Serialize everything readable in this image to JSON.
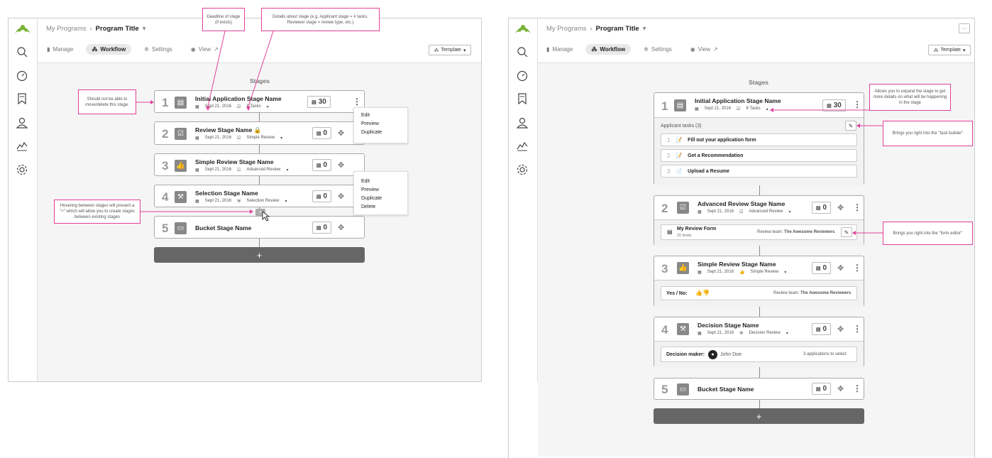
{
  "left": {
    "breadcrumb": {
      "root": "My Programs",
      "sep": "›",
      "current": "Program Title",
      "caret": "▾"
    },
    "tabs": [
      {
        "label": "Manage",
        "icon": "bookmark-icon"
      },
      {
        "label": "Workflow",
        "icon": "sitemap-icon",
        "active": true
      },
      {
        "label": "Settings",
        "icon": "gear-icon"
      },
      {
        "label": "View",
        "icon": "eye-icon"
      }
    ],
    "template_label": "Template",
    "stages_title": "Stages",
    "stages": [
      {
        "num": "1",
        "name": "Initial Application Stage Name",
        "date": "Sept 21, 2016",
        "detail": "8 Tasks",
        "count": "30",
        "icon": "document-icon"
      },
      {
        "num": "2",
        "name": "Review Stage Name",
        "date": "",
        "detail": "Simple Review",
        "count": "0",
        "icon": "checkbox-icon"
      },
      {
        "num": "3",
        "name": "Simple Review Stage Name",
        "date": "Sept 21, 2016",
        "detail": "Advanced Review",
        "count": "0",
        "icon": "thumbs-up-icon"
      },
      {
        "num": "4",
        "name": "Selection Stage Name",
        "date": "Sept 21, 2016",
        "detail": "Selection Review",
        "count": "0",
        "icon": "gavel-icon"
      },
      {
        "num": "5",
        "name": "Bucket Stage Name",
        "date": "",
        "detail": "",
        "count": "0",
        "icon": "inbox-icon"
      }
    ],
    "menu1": [
      "Edit",
      "Preview",
      "Duplicate"
    ],
    "menu2": [
      "Edit",
      "Preview",
      "Duplicate",
      "Delete"
    ],
    "notes": {
      "deadline": "Deadline of stage (if exists)",
      "details": "Details about stage (e.g. Applicant stage = # tasks, Reviewer stage = review type, etc.)",
      "nomove": "Should not be able to move/delete this stage.",
      "hover": "Hovering between stages will present a \"+\" which will allow you to create stages between existing stages"
    },
    "add": "+"
  },
  "right": {
    "breadcrumb": {
      "root": "My Programs",
      "sep": "›",
      "current": "Program Title",
      "caret": "▾"
    },
    "more": "···",
    "tabs": [
      {
        "label": "Manage"
      },
      {
        "label": "Workflow",
        "active": true
      },
      {
        "label": "Settings"
      },
      {
        "label": "View"
      }
    ],
    "template_label": "Template",
    "stages_title": "Stages",
    "stage1": {
      "num": "1",
      "name": "Initial Application Stage Name",
      "date": "Sept 21, 2016",
      "detail": "8 Tasks",
      "count": "30"
    },
    "applicant_tasks": "Applicant tasks (3)",
    "tasks": [
      {
        "n": "1",
        "label": "Fill out your application form"
      },
      {
        "n": "2",
        "label": "Get a Recommendation"
      },
      {
        "n": "3",
        "label": "Upload a Resume"
      }
    ],
    "stage2": {
      "num": "2",
      "name": "Advanced Review Stage Name",
      "date": "Sept 21, 2016",
      "detail": "Advanced Review",
      "count": "0"
    },
    "form": {
      "name": "My Review Form",
      "fields": "20 fields",
      "team_label": "Review team:",
      "team": "The Awesome Reviewers"
    },
    "stage3": {
      "num": "3",
      "name": "Simple Review Stage Name",
      "date": "Sept 21, 2016",
      "detail": "Simple Review",
      "count": "0"
    },
    "yesno": {
      "label": "Yes / No:",
      "team_label": "Review team:",
      "team": "The Awesome Reviewers"
    },
    "stage4": {
      "num": "4",
      "name": "Decision Stage Name",
      "date": "Sept 21, 2016",
      "detail": "Decision Review",
      "count": "0"
    },
    "decision": {
      "label": "Decision maker:",
      "person": "John Doe",
      "apps": "3 applications to select"
    },
    "stage5": {
      "num": "5",
      "name": "Bucket Stage Name",
      "count": "0"
    },
    "notes": {
      "expand": "Allows you to expand the stage to get more details on what will be happening in the stage",
      "task_builder": "Brings you right into the \"task builder\"",
      "form_editor": "Brings you right into the \"form editor\""
    },
    "add": "+"
  }
}
